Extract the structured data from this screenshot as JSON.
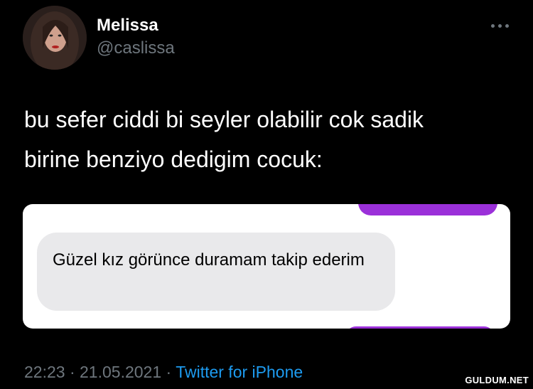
{
  "author": {
    "name": "Melissa",
    "handle": "@caslissa"
  },
  "tweet": {
    "text": "bu sefer ciddi bi seyler olabilir cok sadik\nbirine benziyo dedigim cocuk:"
  },
  "embedded_screenshot": {
    "message_text": "Güzel kız görünce duramam takip ederim",
    "sent_bubble_color": "#9b30d9",
    "received_bubble_color": "#e9e9eb"
  },
  "meta": {
    "time": "22:23",
    "separator": "·",
    "date": "21.05.2021",
    "source": "Twitter for iPhone"
  },
  "watermark": "GULDUM.NET",
  "colors": {
    "background": "#000000",
    "secondary_text": "#6e767d",
    "link": "#1d9bf0"
  },
  "icons": {
    "more": "more-options-icon"
  }
}
